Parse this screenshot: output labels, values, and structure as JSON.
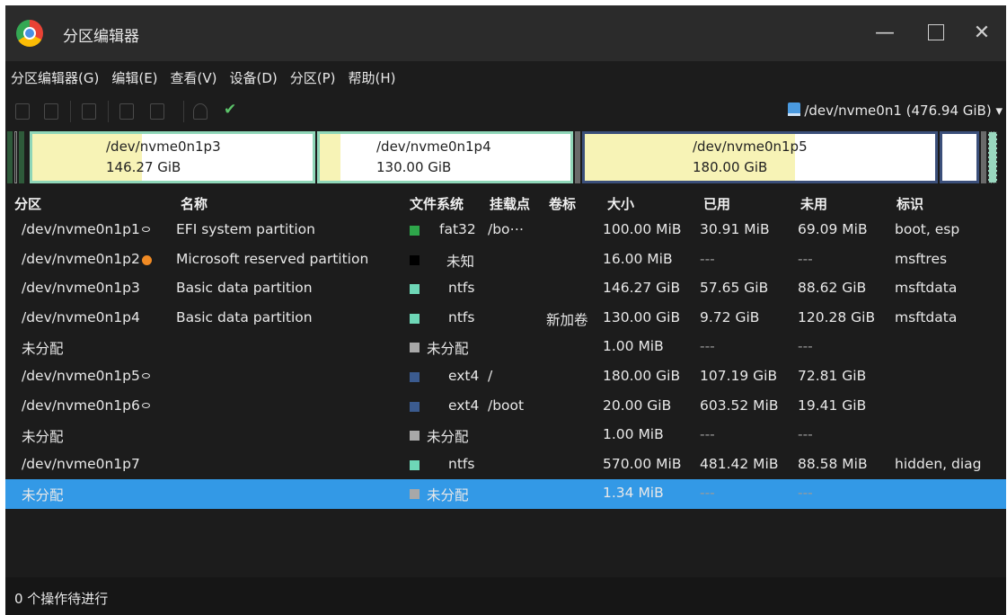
{
  "window": {
    "title": "分区编辑器"
  },
  "menu": [
    "分区编辑器(G)",
    "编辑(E)",
    "查看(V)",
    "设备(D)",
    "分区(P)",
    "帮助(H)"
  ],
  "device": {
    "label": "/dev/nvme0n1 (476.94 GiB)",
    "arrow": "▾"
  },
  "partition_map": [
    {
      "name": "/dev/nvme0n1p3",
      "size": "146.27 GiB"
    },
    {
      "name": "/dev/nvme0n1p4",
      "size": "130.00 GiB"
    },
    {
      "name": "/dev/nvme0n1p5",
      "size": "180.00 GiB"
    }
  ],
  "columns": [
    "分区",
    "名称",
    "文件系统",
    "挂载点",
    "卷标",
    "大小",
    "已用",
    "未用",
    "标识"
  ],
  "rows": [
    {
      "partition": "/dev/nvme0n1p1",
      "marker": "key",
      "name": "EFI system partition",
      "fs_color": "#2ea64a",
      "fs": "fat32",
      "mount": "/bo⋯",
      "label": "",
      "size": "100.00 MiB",
      "used": "30.91 MiB",
      "unused": "69.09 MiB",
      "flags": "boot, esp"
    },
    {
      "partition": "/dev/nvme0n1p2",
      "marker": "warn",
      "name": "Microsoft reserved partition",
      "fs_color": "#000000",
      "fs": "未知",
      "mount": "",
      "label": "",
      "size": "16.00 MiB",
      "used": "---",
      "unused": "---",
      "flags": "msftres"
    },
    {
      "partition": "/dev/nvme0n1p3",
      "marker": "",
      "name": "Basic data partition",
      "fs_color": "#6ed7b7",
      "fs": "ntfs",
      "mount": "",
      "label": "",
      "size": "146.27 GiB",
      "used": "57.65 GiB",
      "unused": "88.62 GiB",
      "flags": "msftdata"
    },
    {
      "partition": "/dev/nvme0n1p4",
      "marker": "",
      "name": "Basic data partition",
      "fs_color": "#6ed7b7",
      "fs": "ntfs",
      "mount": "",
      "label": "新加卷",
      "size": "130.00 GiB",
      "used": "9.72 GiB",
      "unused": "120.28 GiB",
      "flags": "msftdata"
    },
    {
      "partition": "未分配",
      "marker": "",
      "name": "",
      "fs_color": "#a8a8a8",
      "fs": "未分配",
      "mount": "",
      "label": "",
      "size": "1.00 MiB",
      "used": "---",
      "unused": "---",
      "flags": ""
    },
    {
      "partition": "/dev/nvme0n1p5",
      "marker": "key",
      "name": "",
      "fs_color": "#3b5b8f",
      "fs": "ext4",
      "mount": "/",
      "label": "",
      "size": "180.00 GiB",
      "used": "107.19 GiB",
      "unused": "72.81 GiB",
      "flags": ""
    },
    {
      "partition": "/dev/nvme0n1p6",
      "marker": "key",
      "name": "",
      "fs_color": "#3b5b8f",
      "fs": "ext4",
      "mount": "/boot",
      "label": "",
      "size": "20.00 GiB",
      "used": "603.52 MiB",
      "unused": "19.41 GiB",
      "flags": ""
    },
    {
      "partition": "未分配",
      "marker": "",
      "name": "",
      "fs_color": "#a8a8a8",
      "fs": "未分配",
      "mount": "",
      "label": "",
      "size": "1.00 MiB",
      "used": "---",
      "unused": "---",
      "flags": ""
    },
    {
      "partition": "/dev/nvme0n1p7",
      "marker": "",
      "name": "",
      "fs_color": "#6ed7b7",
      "fs": "ntfs",
      "mount": "",
      "label": "",
      "size": "570.00 MiB",
      "used": "481.42 MiB",
      "unused": "88.58 MiB",
      "flags": "hidden, diag"
    },
    {
      "partition": "未分配",
      "marker": "",
      "name": "",
      "fs_color": "#a8a8a8",
      "fs": "未分配",
      "mount": "",
      "label": "",
      "size": "1.34 MiB",
      "used": "---",
      "unused": "---",
      "flags": "",
      "selected": true
    }
  ],
  "status": "0 个操作待进行"
}
